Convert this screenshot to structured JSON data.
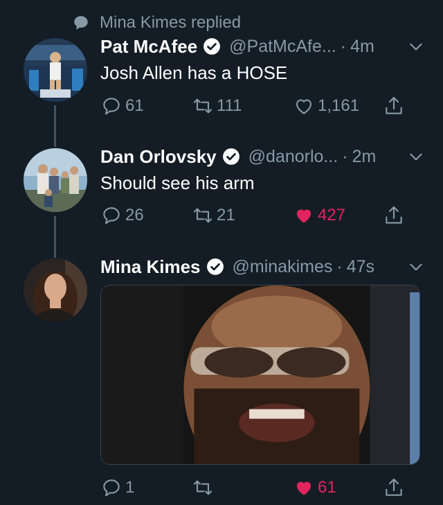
{
  "context": {
    "text": "Mina Kimes replied"
  },
  "tweets": [
    {
      "name": "Pat McAfee",
      "handle": "@PatMcAfe...",
      "time": "4m",
      "text": "Josh Allen has a HOSE",
      "replies": "61",
      "retweets": "111",
      "likes": "1,161",
      "liked": false
    },
    {
      "name": "Dan Orlovsky",
      "handle": "@danorlo...",
      "time": "2m",
      "text": "Should see his arm",
      "replies": "26",
      "retweets": "21",
      "likes": "427",
      "liked": true
    },
    {
      "name": "Mina Kimes",
      "handle": "@minakimes",
      "time": "47s",
      "text": "",
      "replies": "1",
      "retweets": "",
      "likes": "61",
      "liked": true
    }
  ],
  "separator": "·",
  "colors": {
    "background": "#141d26",
    "secondary_text": "#8899a6",
    "like_red": "#e0245e",
    "verified_badge": "#ffffff",
    "thread_line": "#3d5466"
  },
  "icons": [
    "speech-bubble-icon",
    "verified-badge-icon",
    "chevron-down-icon",
    "reply-icon",
    "retweet-icon",
    "like-icon",
    "share-icon"
  ]
}
